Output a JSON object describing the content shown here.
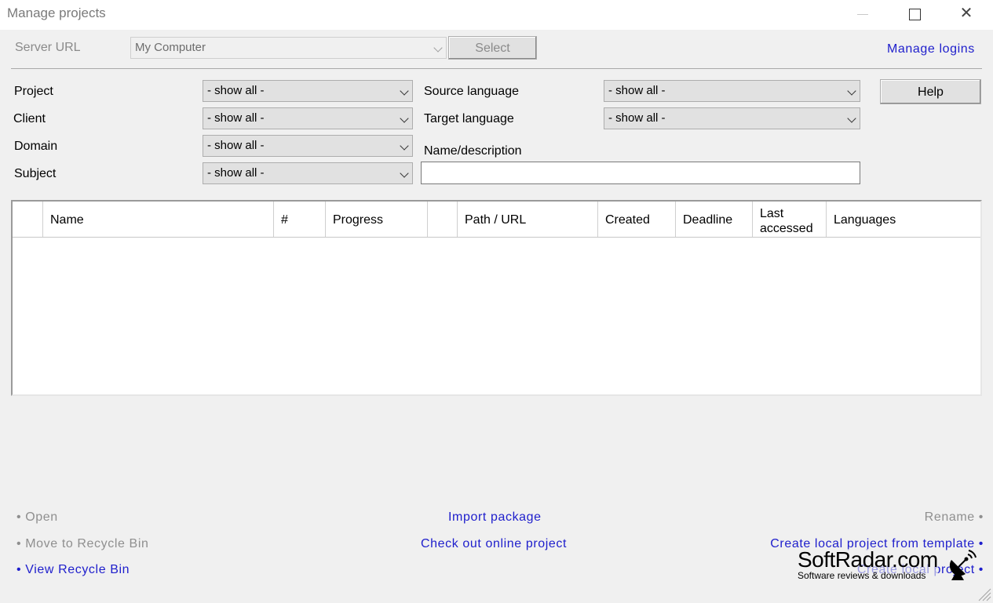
{
  "window": {
    "title": "Manage projects"
  },
  "server": {
    "label": "Server URL",
    "value": "My Computer",
    "select_label": "Select",
    "manage_logins": "Manage logins"
  },
  "filters": {
    "project": {
      "label": "Project",
      "value": "- show all -"
    },
    "client": {
      "label": "Client",
      "value": "- show all -"
    },
    "domain": {
      "label": "Domain",
      "value": "- show all -"
    },
    "subject": {
      "label": "Subject",
      "value": "- show all -"
    },
    "source_language": {
      "label": "Source language",
      "value": "- show all -"
    },
    "target_language": {
      "label": "Target language",
      "value": "- show all -"
    },
    "name_description": {
      "label": "Name/description",
      "value": ""
    },
    "help_label": "Help"
  },
  "table": {
    "columns": [
      "",
      "Name",
      "#",
      "Progress",
      "",
      "Path / URL",
      "Created",
      "Deadline",
      "Last accessed",
      "Languages"
    ],
    "rows": []
  },
  "actions": {
    "open": "• Open",
    "move_to_recycle_bin": "• Move to Recycle Bin",
    "view_recycle_bin": "• View Recycle Bin",
    "import_package": "Import package",
    "check_out_online_project": "Check out online project",
    "rename": "Rename •",
    "create_from_template": "Create local project from template •",
    "create_local_project": "Create local project •"
  },
  "watermark": {
    "brand": "SoftRadar.com",
    "tagline": "Software reviews & downloads"
  },
  "colors": {
    "link": "#1e1ecc",
    "disabled_text": "#8a8a8a",
    "background": "#f0f0f0"
  }
}
